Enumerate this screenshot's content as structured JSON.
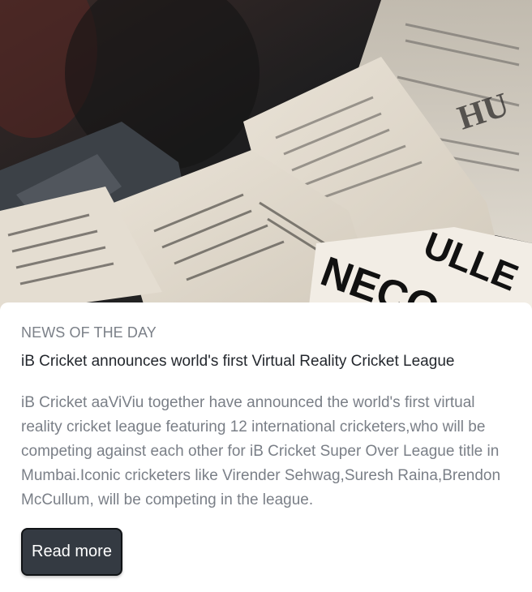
{
  "hero": {
    "image_label": "newspapers-photo"
  },
  "card": {
    "kicker": "NEWS OF THE DAY",
    "title": "iB Cricket announces world's first Virtual Reality Cricket League",
    "description": "iB Cricket aaViViu together have announced the world's first virtual reality cricket league featuring 12 international cricketers,who will be competing against each other for iB Cricket Super Over League title in Mumbai.Iconic cricketers like Virender Sehwag,Suresh Raina,Brendon McCullum, will be competing in the league.",
    "button_label": "Read more"
  },
  "colors": {
    "kicker": "#7b8088",
    "title": "#23272d",
    "description": "#7a7f87",
    "button_bg": "#343a42",
    "button_text": "#ffffff"
  }
}
